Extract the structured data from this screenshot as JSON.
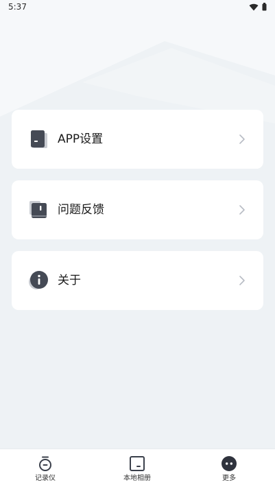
{
  "status_bar": {
    "time": "5:37",
    "icons": [
      "wifi-icon",
      "battery-icon"
    ]
  },
  "menu": {
    "items": [
      {
        "label": "APP设置",
        "icon": "app-settings-icon"
      },
      {
        "label": "问题反馈",
        "icon": "feedback-book-icon"
      },
      {
        "label": "关于",
        "icon": "info-icon"
      }
    ],
    "chevron_icon": "chevron-right-icon"
  },
  "bottom_nav": {
    "items": [
      {
        "label": "记录仪",
        "icon": "recorder-icon"
      },
      {
        "label": "本地相册",
        "icon": "album-icon"
      },
      {
        "label": "更多",
        "icon": "more-icon",
        "active": true
      }
    ]
  },
  "colors": {
    "background": "#eef2f5",
    "card": "#ffffff",
    "icon_dark": "#454a55",
    "icon_shadow": "#c9ccd2",
    "chevron": "#b8bcc4"
  }
}
